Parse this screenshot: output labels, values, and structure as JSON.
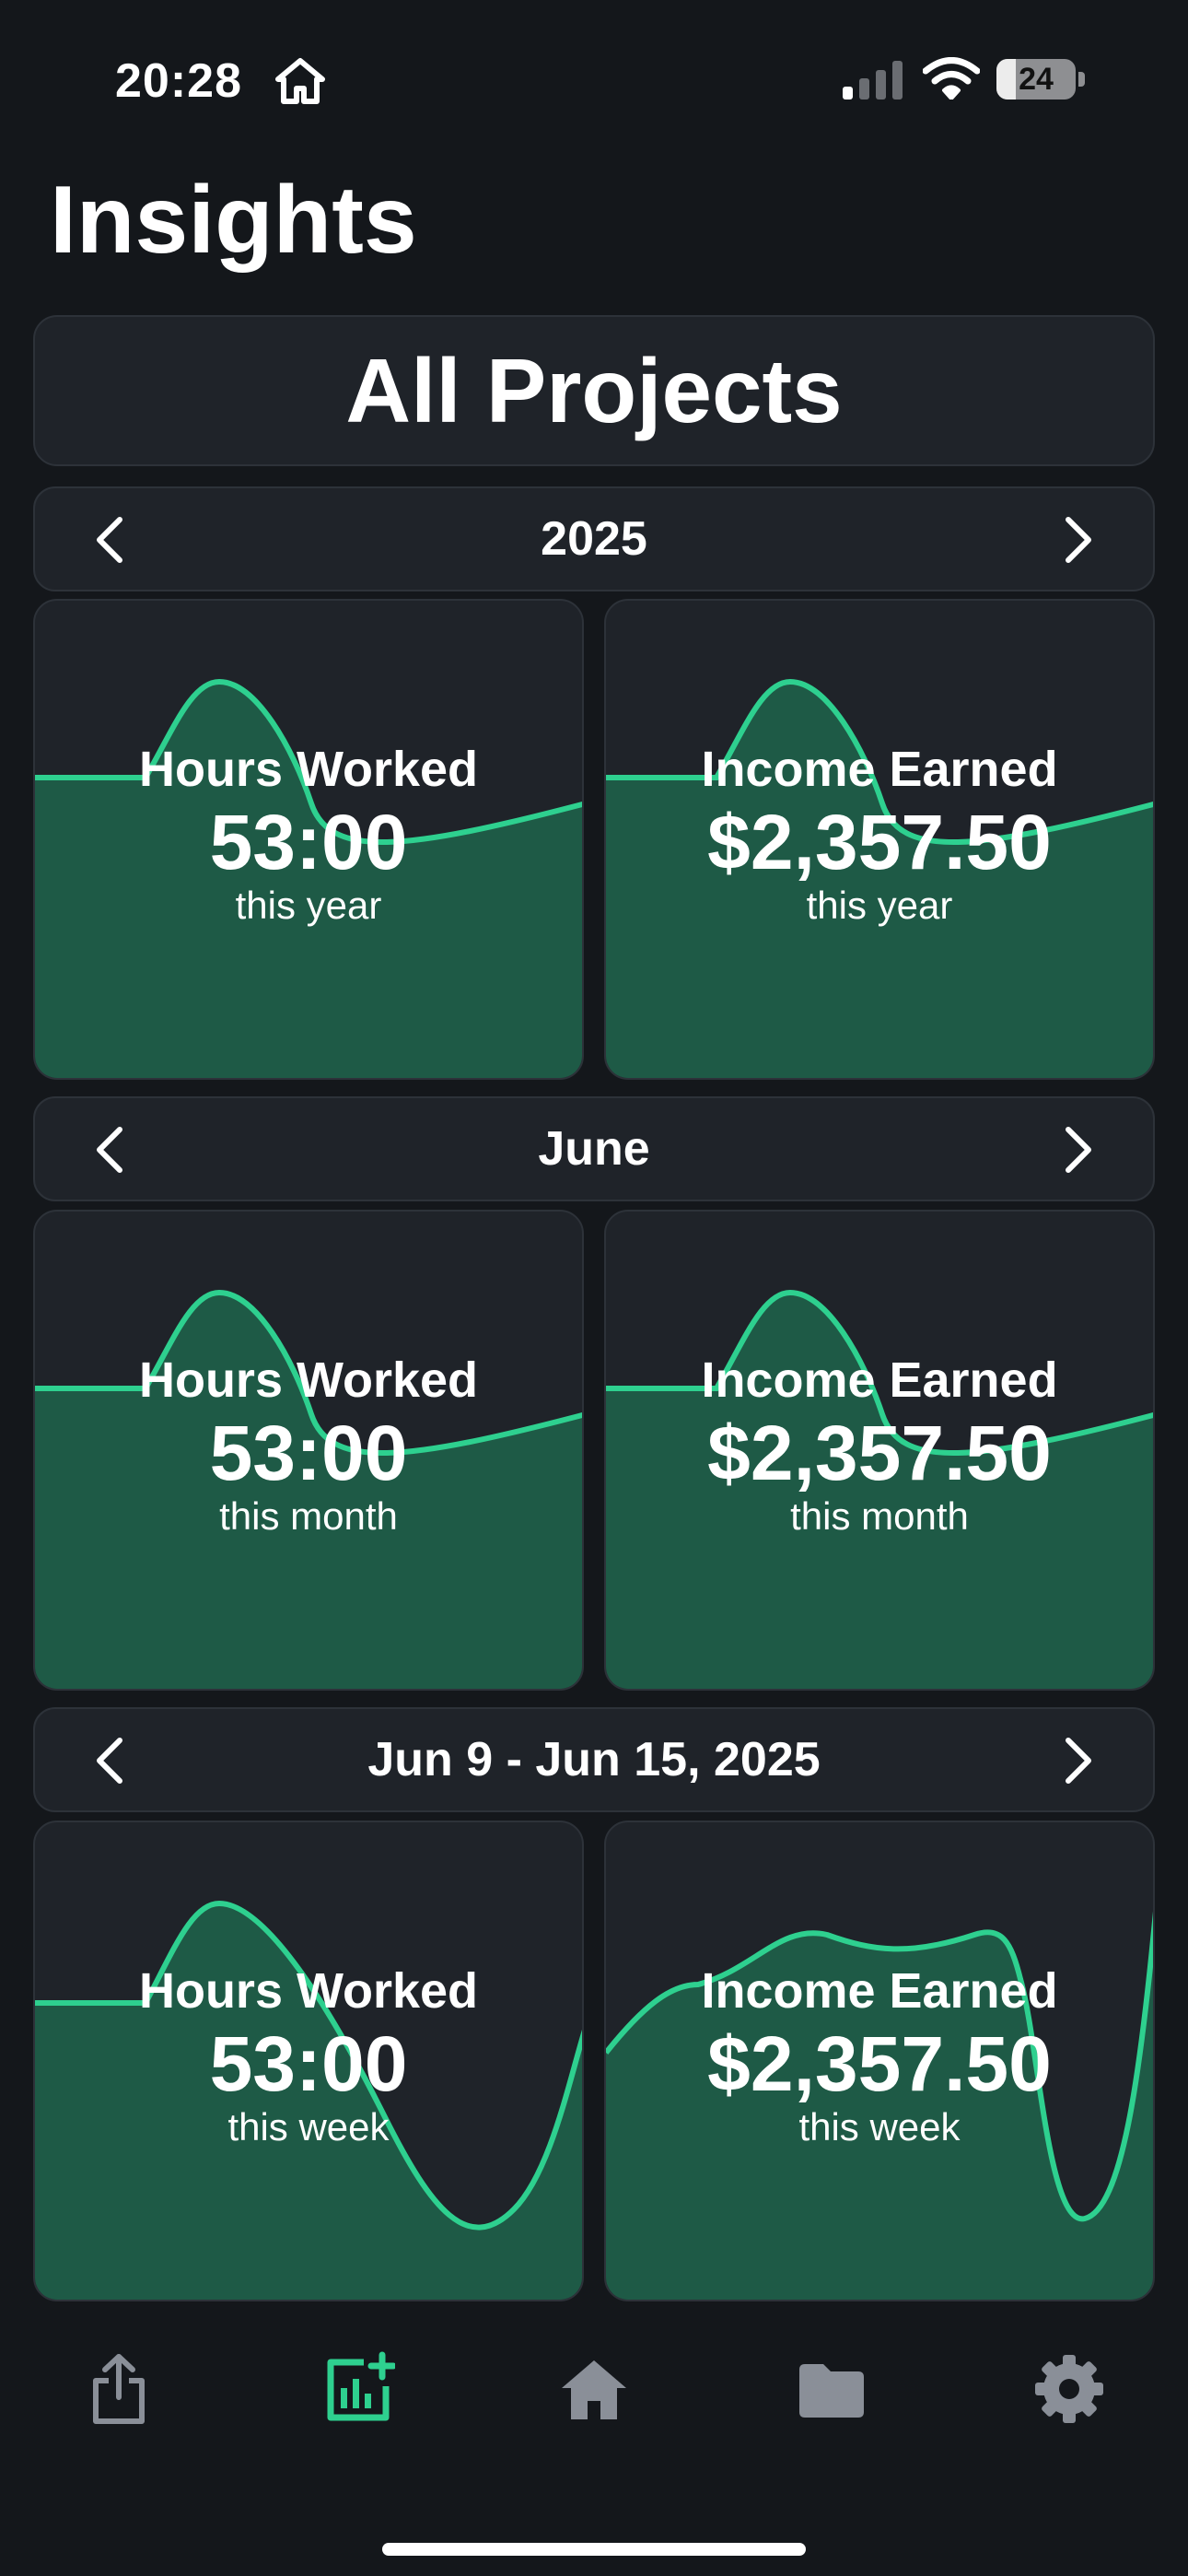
{
  "status_bar": {
    "time": "20:28",
    "battery": "24",
    "battery_level": 0.24
  },
  "header": {
    "title": "Insights"
  },
  "project_selector": {
    "label": "All Projects"
  },
  "colors": {
    "accent": "#2ed08f",
    "card_fill": "#1e5a46",
    "card_bg": "#1f2329",
    "background": "#14171b",
    "icon_inactive": "#8a8f98"
  },
  "sections": [
    {
      "period_label": "2025",
      "cards": [
        {
          "label": "Hours Worked",
          "value": "53:00",
          "sub": "this year"
        },
        {
          "label": "Income Earned",
          "value": "$2,357.50",
          "sub": "this year"
        }
      ]
    },
    {
      "period_label": "June",
      "cards": [
        {
          "label": "Hours Worked",
          "value": "53:00",
          "sub": "this month"
        },
        {
          "label": "Income Earned",
          "value": "$2,357.50",
          "sub": "this month"
        }
      ]
    },
    {
      "period_label": "Jun 9 - Jun 15, 2025",
      "cards": [
        {
          "label": "Hours Worked",
          "value": "53:00",
          "sub": "this week"
        },
        {
          "label": "Income Earned",
          "value": "$2,357.50",
          "sub": "this week"
        }
      ]
    }
  ],
  "tab_bar": {
    "items": [
      {
        "name": "share-icon",
        "active": false
      },
      {
        "name": "insights-chart-icon",
        "active": true
      },
      {
        "name": "home-icon",
        "active": false
      },
      {
        "name": "folder-icon",
        "active": false
      },
      {
        "name": "gear-icon",
        "active": false
      }
    ]
  }
}
